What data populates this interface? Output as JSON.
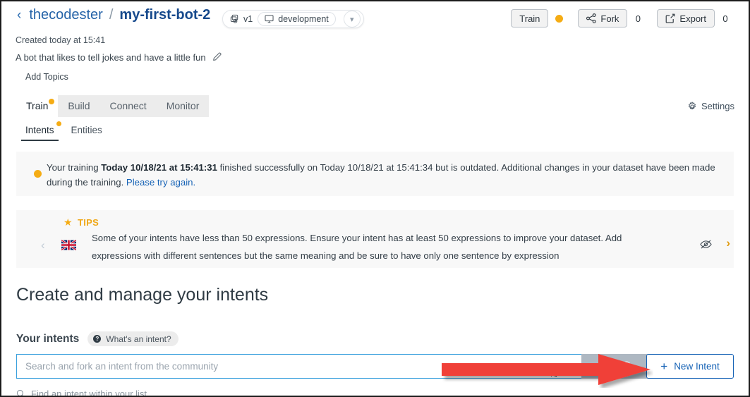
{
  "header": {
    "back_icon": "chevron-left-icon",
    "owner": "thecodester",
    "separator": "/",
    "bot_name": "my-first-bot-2",
    "version_label": "v1",
    "version_icon": "versions-icon",
    "environment_label": "development",
    "environment_icon": "monitor-icon",
    "caret_icon": "chevron-down-icon",
    "actions": [
      {
        "label": "Train",
        "side": "",
        "side_type": "dot",
        "dot_color": "#f5ac14",
        "icon": ""
      },
      {
        "label": "Fork",
        "side": "0",
        "side_type": "count",
        "icon": "fork-icon"
      },
      {
        "label": "Export",
        "side": "0",
        "side_type": "count",
        "icon": "export-icon"
      }
    ]
  },
  "meta": {
    "created": "Created today at 15:41",
    "description": "A bot that likes to tell jokes and have a little fun",
    "edit_icon": "pencil-icon",
    "add_topics": "Add Topics"
  },
  "tabs": {
    "main": [
      {
        "label": "Train",
        "active": true,
        "dot": true
      },
      {
        "label": "Build",
        "active": false,
        "dot": false
      },
      {
        "label": "Connect",
        "active": false,
        "dot": false
      },
      {
        "label": "Monitor",
        "active": false,
        "dot": false
      }
    ],
    "settings_label": "Settings",
    "settings_icon": "gear-icon",
    "sub": [
      {
        "label": "Intents",
        "active": true,
        "dot": true
      },
      {
        "label": "Entities",
        "active": false,
        "dot": false
      }
    ]
  },
  "training_banner": {
    "status_icon": "amber-dot-icon",
    "prefix": "Your training ",
    "bold_start": "Today 10/18/21 at 15:41:31",
    "middle": " finished successfully on Today 10/18/21 at 15:41:34 but is outdated. Additional changes in your dataset have been made during the training. ",
    "link": "Please try again."
  },
  "tips_banner": {
    "star_icon": "star-icon",
    "label": "TIPS",
    "prev_icon": "chevron-left-icon",
    "next_icon": "chevron-right-icon",
    "hide_icon": "eye-off-icon",
    "flag_icon": "uk-flag-icon",
    "text": "Some of your intents have less than 50 expressions. Ensure your intent has at least 50 expressions to improve your dataset. Add expressions with different sentences but the same meaning and be sure to have only one sentence by expression"
  },
  "main": {
    "heading": "Create and manage your intents",
    "your_intents_label": "Your intents",
    "whats_intent_badge": "What's an intent?",
    "whats_intent_icon": "help-icon",
    "search_placeholder": "Search and fork an intent from the community",
    "search_value": "",
    "search_button_icon": "search-icon",
    "new_intent_label": "New Intent",
    "new_intent_icon": "plus-icon",
    "find_placeholder": "Find an intent within your list",
    "find_icon": "search-icon"
  },
  "annotation": {
    "arrow_icon": "red-arrow-icon",
    "arrow_color": "#f03f37"
  },
  "colors": {
    "accent_blue": "#1763b6",
    "amber": "#f5ac14",
    "banner_bg": "#f8f8f8",
    "tabbar_bg": "#ececec",
    "search_button_bg": "#aeb8c2"
  }
}
